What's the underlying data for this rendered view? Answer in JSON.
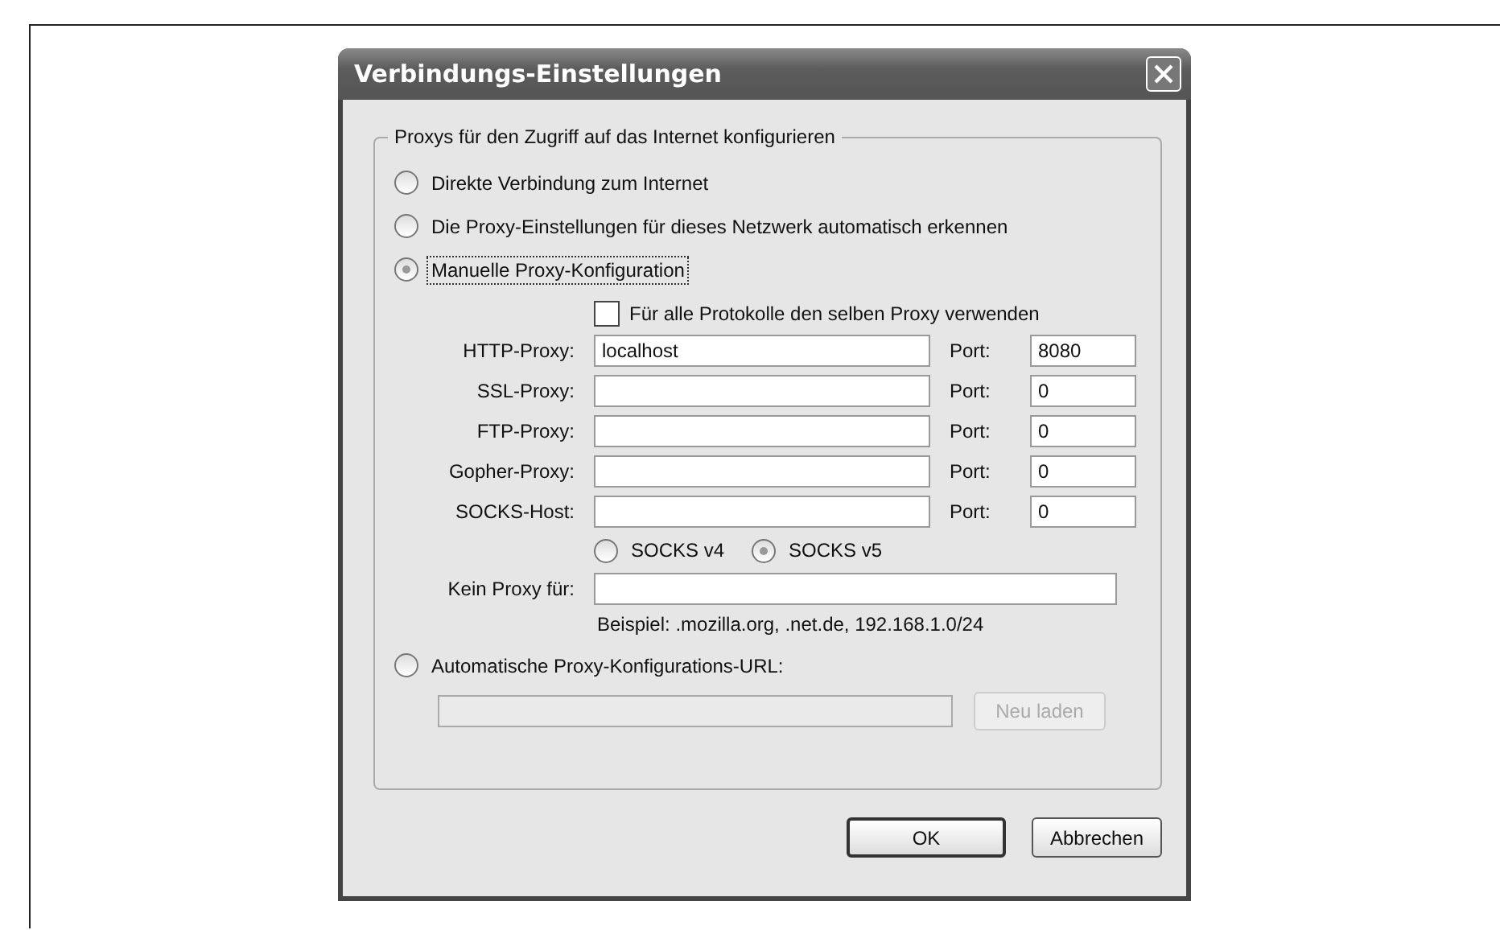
{
  "window": {
    "title": "Verbindungs-Einstellungen"
  },
  "group": {
    "legend": "Proxys für den Zugriff auf das Internet konfigurieren",
    "modes": [
      {
        "label": "Direkte Verbindung zum Internet",
        "selected": false,
        "focused": false
      },
      {
        "label": "Die Proxy-Einstellungen für dieses Netzwerk automatisch erkennen",
        "selected": false,
        "focused": false
      },
      {
        "label": "Manuelle Proxy-Konfiguration",
        "selected": true,
        "focused": true
      },
      {
        "label": "Automatische Proxy-Konfigurations-URL:",
        "selected": false,
        "focused": false
      }
    ],
    "same_proxy": {
      "label": "Für alle Protokolle den selben Proxy verwenden",
      "checked": false
    },
    "proxies": [
      {
        "label": "HTTP-Proxy:",
        "value": "localhost",
        "port_label": "Port:",
        "port": "8080"
      },
      {
        "label": "SSL-Proxy:",
        "port_label": "Port:",
        "port": "0"
      },
      {
        "label": "FTP-Proxy:",
        "port_label": "Port:",
        "port": "0"
      },
      {
        "label": "Gopher-Proxy:",
        "port_label": "Port:",
        "port": "0"
      },
      {
        "label": "SOCKS-Host:",
        "port_label": "Port:",
        "port": "0"
      }
    ],
    "socks_versions": [
      {
        "label": "SOCKS v4",
        "selected": false
      },
      {
        "label": "SOCKS v5",
        "selected": true
      }
    ],
    "no_proxy": {
      "label": "Kein Proxy für:"
    },
    "example": "Beispiel: .mozilla.org, .net.de, 192.168.1.0/24",
    "auto_url": {
      "disabled": true,
      "reload_button": "Neu laden"
    }
  },
  "buttons": [
    {
      "label": "OK",
      "default": true
    },
    {
      "label": "Abbrechen",
      "default": false
    }
  ]
}
